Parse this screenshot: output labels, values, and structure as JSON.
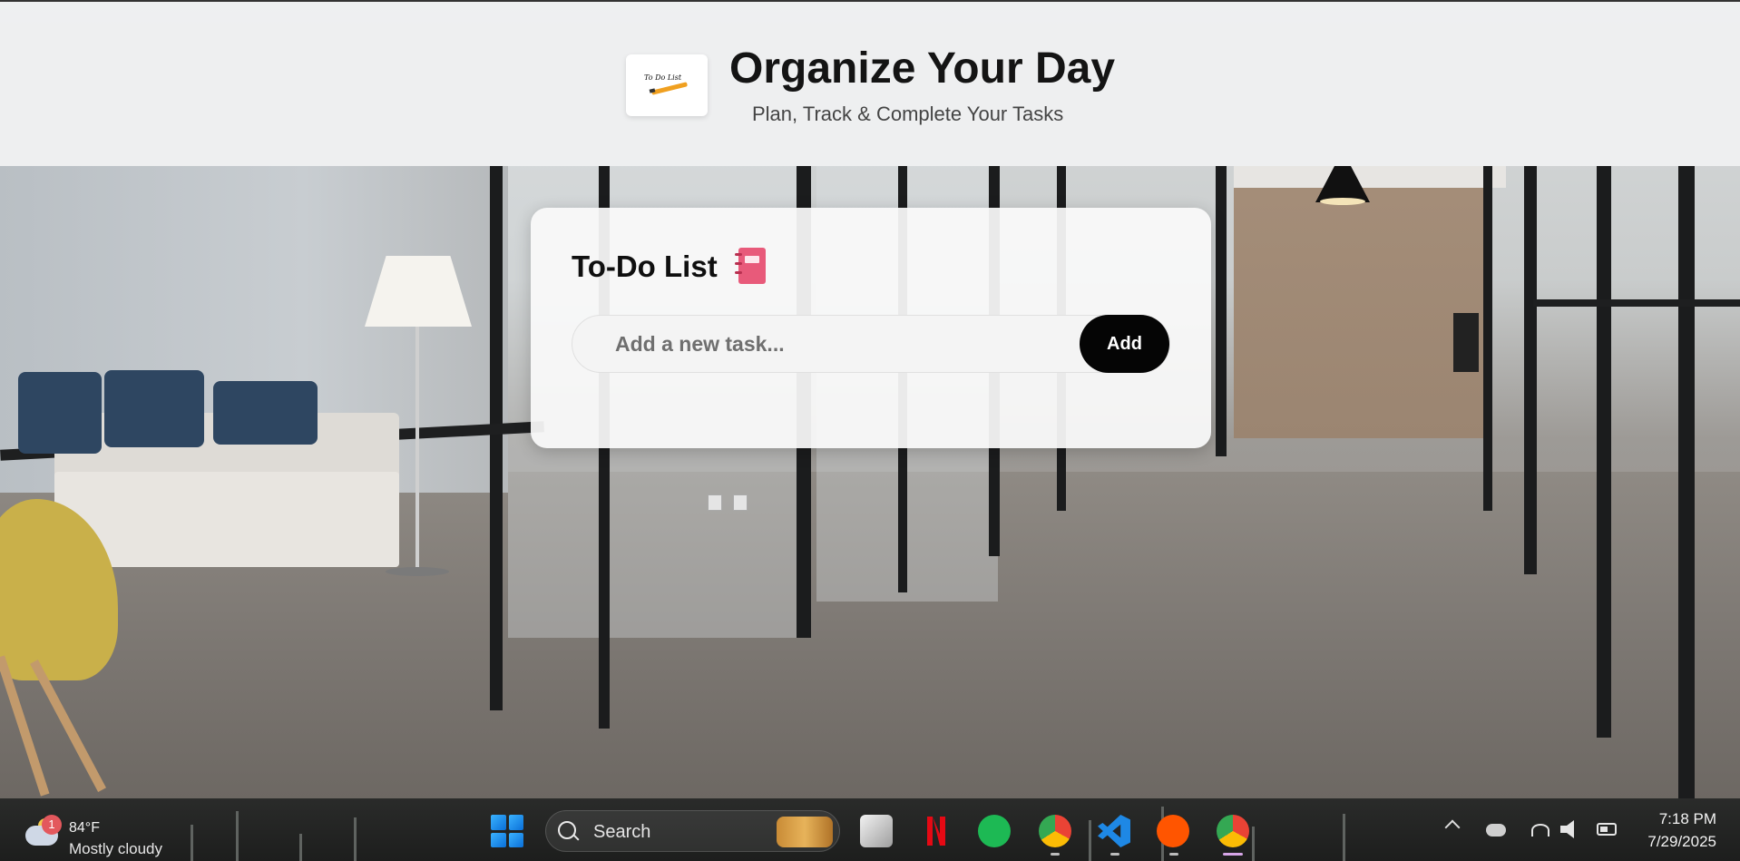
{
  "header": {
    "title": "Organize Your Day",
    "subtitle": "Plan, Track & Complete Your Tasks",
    "logo_text": "To Do List"
  },
  "todo": {
    "title": "To-Do List",
    "input_placeholder": "Add a new task...",
    "input_value": "",
    "add_label": "Add"
  },
  "taskbar": {
    "weather": {
      "badge": "1",
      "temp": "84°F",
      "desc": "Mostly cloudy"
    },
    "search_label": "Search",
    "apps": [
      "start-icon",
      "task-view-icon",
      "netflix-icon",
      "spotify-icon",
      "chrome-icon",
      "vscode-icon",
      "soundcloud-icon",
      "chrome-icon"
    ],
    "tray": [
      "chevron-up-icon",
      "onedrive-icon",
      "wifi-icon",
      "speaker-icon",
      "battery-icon"
    ],
    "time": "7:18 PM",
    "date": "7/29/2025"
  },
  "colors": {
    "add_button_bg": "#050505",
    "notebook": "#e85a7a",
    "spotify": "#1db954",
    "netflix": "#e50914",
    "soundcloud": "#ff5500",
    "vscode": "#1e88e5"
  }
}
